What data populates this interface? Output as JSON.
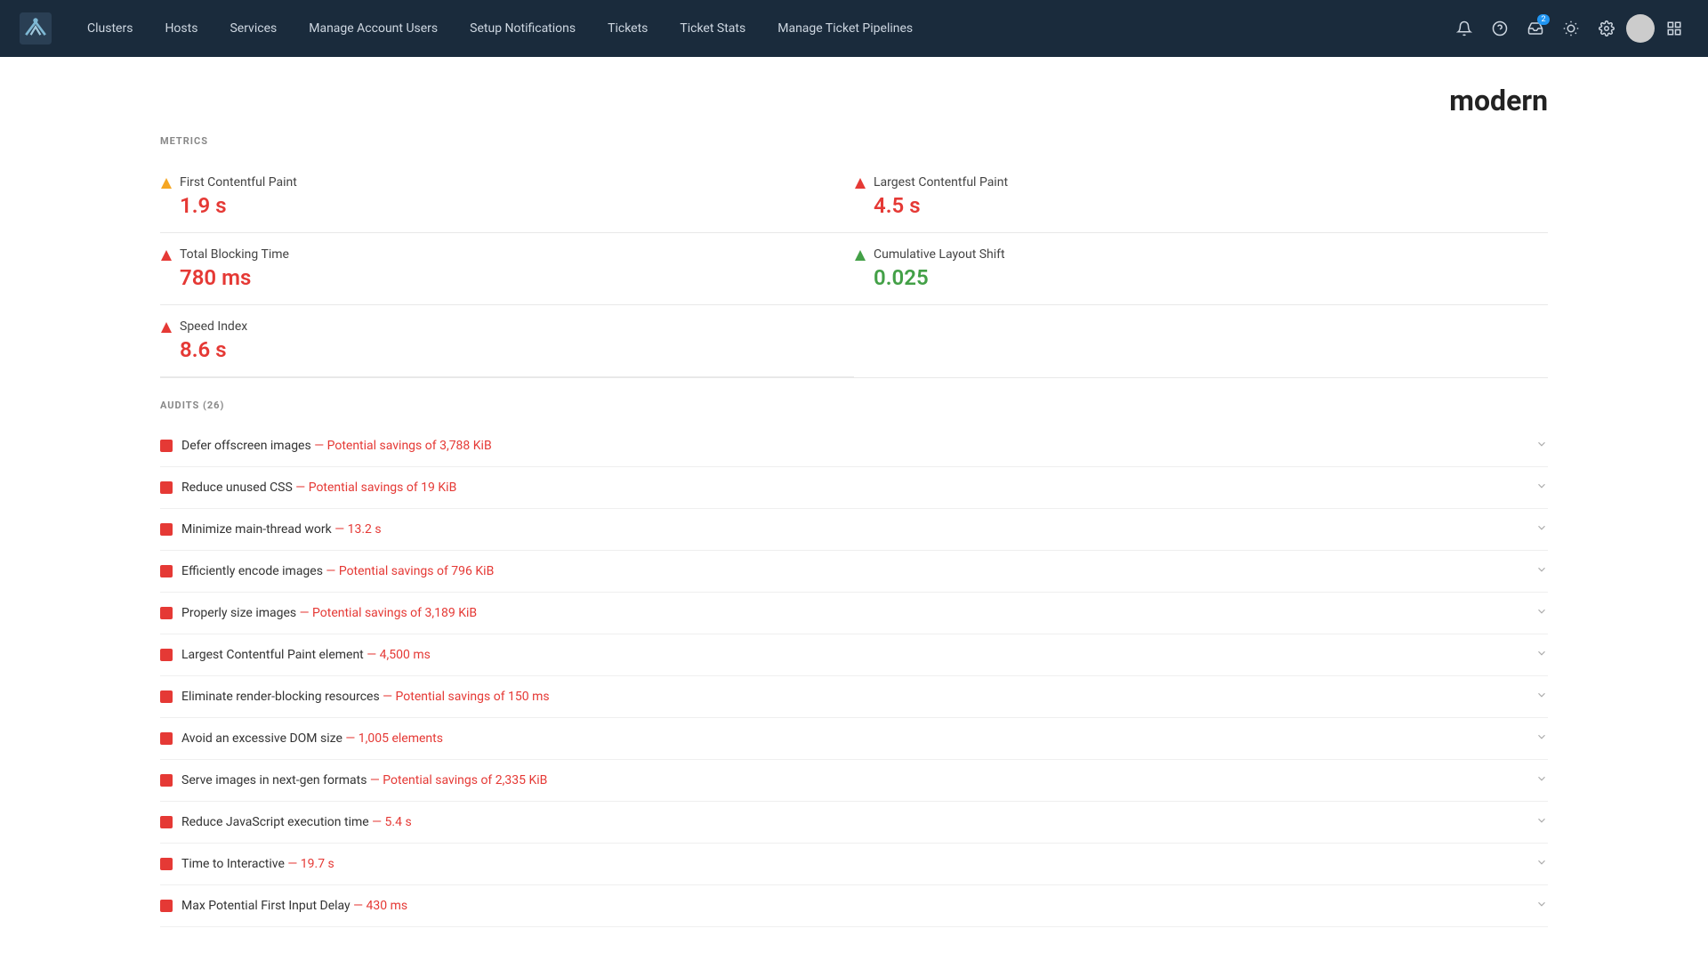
{
  "nav": {
    "links": [
      {
        "label": "Clusters",
        "name": "clusters"
      },
      {
        "label": "Hosts",
        "name": "hosts"
      },
      {
        "label": "Services",
        "name": "services"
      },
      {
        "label": "Manage Account Users",
        "name": "manage-account-users"
      },
      {
        "label": "Setup Notifications",
        "name": "setup-notifications"
      },
      {
        "label": "Tickets",
        "name": "tickets"
      },
      {
        "label": "Ticket Stats",
        "name": "ticket-stats"
      },
      {
        "label": "Manage Ticket Pipelines",
        "name": "manage-ticket-pipelines"
      }
    ],
    "notification_badge": "2"
  },
  "page": {
    "title": "modern"
  },
  "metrics_label": "METRICS",
  "metrics": [
    {
      "label": "First Contentful Paint",
      "value": "1.9 s",
      "color": "orange",
      "icon_type": "triangle-orange"
    },
    {
      "label": "Largest Contentful Paint",
      "value": "4.5 s",
      "color": "red",
      "icon_type": "triangle-red"
    },
    {
      "label": "Total Blocking Time",
      "value": "780 ms",
      "color": "red",
      "icon_type": "triangle-red"
    },
    {
      "label": "Cumulative Layout Shift",
      "value": "0.025",
      "color": "green",
      "icon_type": "triangle-green"
    },
    {
      "label": "Speed Index",
      "value": "8.6 s",
      "color": "red",
      "icon_type": "triangle-red",
      "single": true
    }
  ],
  "audits_label": "AUDITS (26)",
  "audits": [
    {
      "text": "Defer offscreen images",
      "detail": "— Potential savings of 3,788 KiB",
      "detail_color": "red"
    },
    {
      "text": "Reduce unused CSS",
      "detail": "— Potential savings of 19 KiB",
      "detail_color": "red"
    },
    {
      "text": "Minimize main-thread work",
      "detail": "— 13.2 s",
      "detail_color": "red"
    },
    {
      "text": "Efficiently encode images",
      "detail": "— Potential savings of 796 KiB",
      "detail_color": "red"
    },
    {
      "text": "Properly size images",
      "detail": "— Potential savings of 3,189 KiB",
      "detail_color": "red"
    },
    {
      "text": "Largest Contentful Paint element",
      "detail": "— 4,500 ms",
      "detail_color": "red"
    },
    {
      "text": "Eliminate render-blocking resources",
      "detail": "— Potential savings of 150 ms",
      "detail_color": "red"
    },
    {
      "text": "Avoid an excessive DOM size",
      "detail": "— 1,005 elements",
      "detail_color": "red"
    },
    {
      "text": "Serve images in next-gen formats",
      "detail": "— Potential savings of 2,335 KiB",
      "detail_color": "red"
    },
    {
      "text": "Reduce JavaScript execution time",
      "detail": "— 5.4 s",
      "detail_color": "red"
    },
    {
      "text": "Time to Interactive",
      "detail": "— 19.7 s",
      "detail_color": "red"
    },
    {
      "text": "Max Potential First Input Delay",
      "detail": "— 430 ms",
      "detail_color": "red"
    }
  ]
}
